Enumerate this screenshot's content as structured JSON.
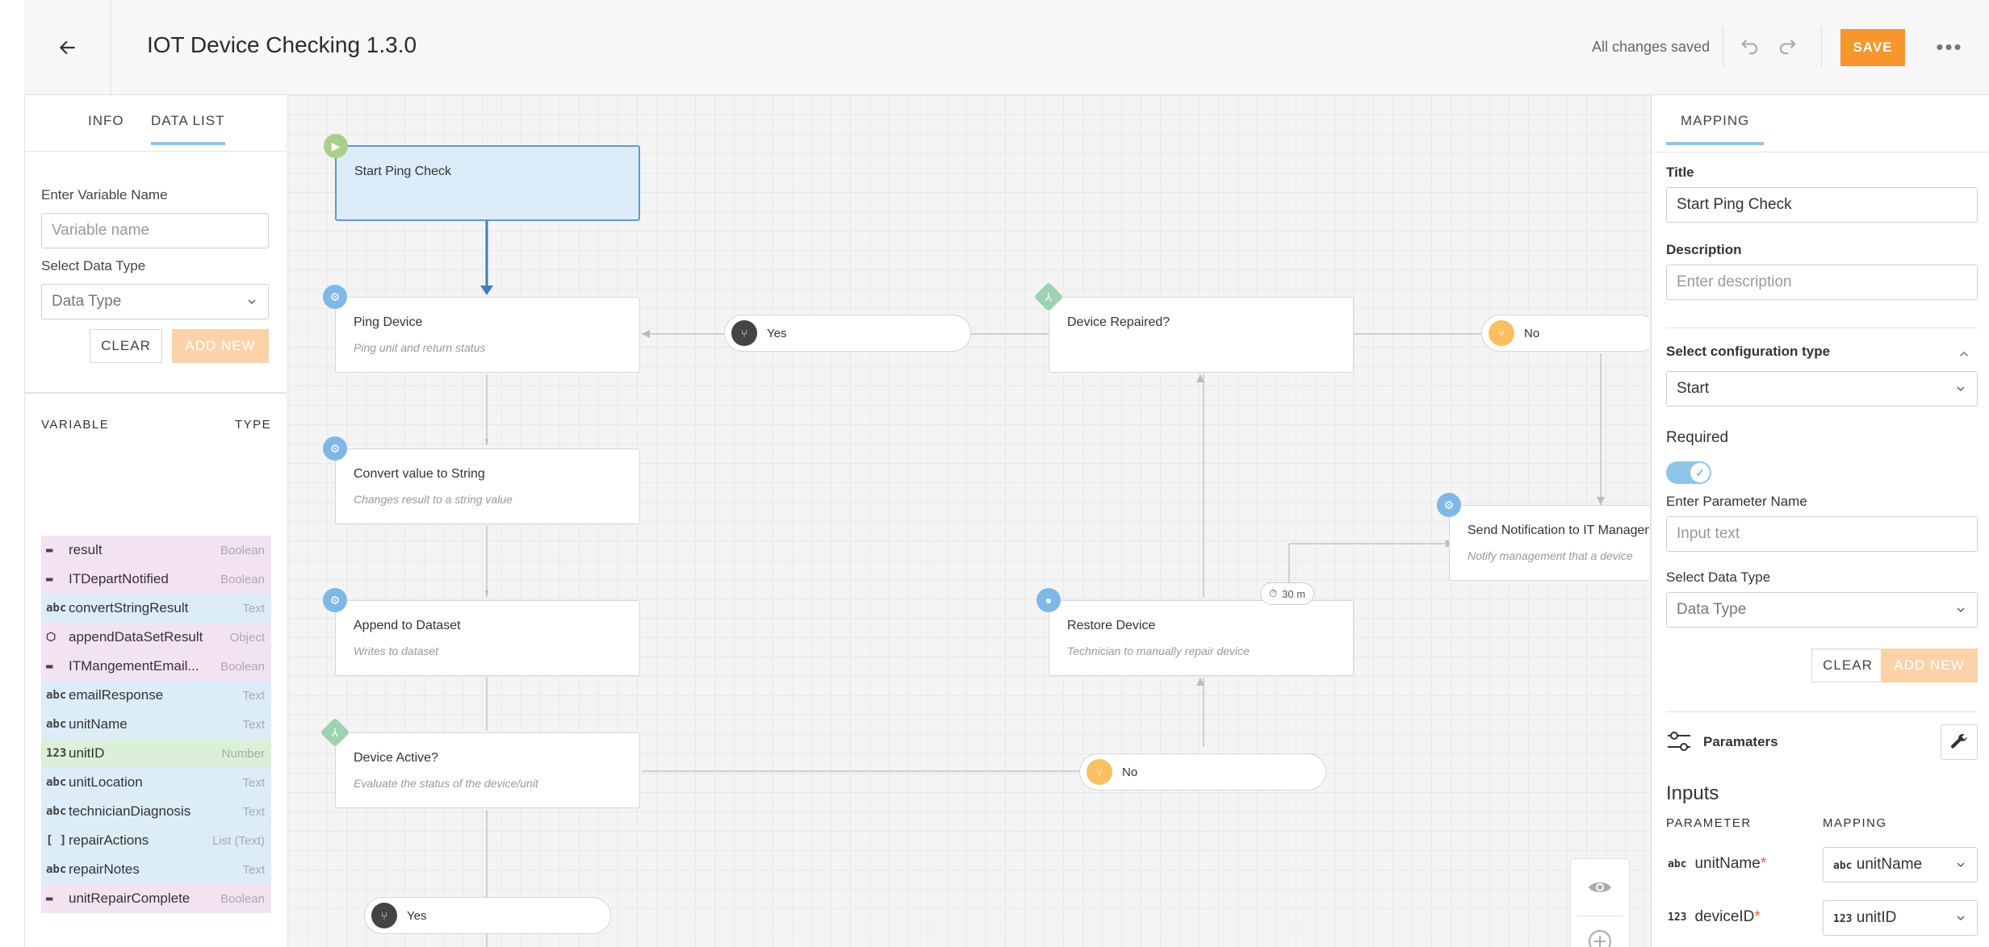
{
  "header": {
    "title": "IOT Device Checking 1.3.0",
    "saved_status": "All changes saved",
    "save_label": "SAVE",
    "more_label": "•••"
  },
  "left_panel": {
    "tabs": [
      {
        "label": "INFO"
      },
      {
        "label": "DATA LIST"
      }
    ],
    "variable_name_label": "Enter Variable Name",
    "variable_name_placeholder": "Variable name",
    "data_type_label": "Select Data Type",
    "data_type_value": "Data Type",
    "clear_label": "CLEAR",
    "add_new_label": "ADD NEW",
    "col_variable": "VARIABLE",
    "col_type": "TYPE",
    "variables": [
      {
        "icon": "▬",
        "name": "result",
        "type": "Boolean",
        "kind": "boolean"
      },
      {
        "icon": "▬",
        "name": "ITDepartNotified",
        "type": "Boolean",
        "kind": "boolean"
      },
      {
        "icon": "abc",
        "name": "convertStringResult",
        "type": "Text",
        "kind": "text"
      },
      {
        "icon": "⬡",
        "name": "appendDataSetResult",
        "type": "Object",
        "kind": "object"
      },
      {
        "icon": "▬",
        "name": "ITMangementEmail...",
        "type": "Boolean",
        "kind": "boolean"
      },
      {
        "icon": "abc",
        "name": "emailResponse",
        "type": "Text",
        "kind": "text"
      },
      {
        "icon": "abc",
        "name": "unitName",
        "type": "Text",
        "kind": "text"
      },
      {
        "icon": "123",
        "name": "unitID",
        "type": "Number",
        "kind": "number"
      },
      {
        "icon": "abc",
        "name": "unitLocation",
        "type": "Text",
        "kind": "text"
      },
      {
        "icon": "abc",
        "name": "technicianDiagnosis",
        "type": "Text",
        "kind": "text"
      },
      {
        "icon": "[ ]",
        "name": "repairActions",
        "type": "List (Text)",
        "kind": "list"
      },
      {
        "icon": "abc",
        "name": "repairNotes",
        "type": "Text",
        "kind": "text"
      },
      {
        "icon": "▬",
        "name": "unitRepairComplete",
        "type": "Boolean",
        "kind": "boolean"
      }
    ]
  },
  "canvas": {
    "nodes": {
      "start": {
        "title": "Start Ping Check",
        "subtitle": ""
      },
      "ping": {
        "title": "Ping Device",
        "subtitle": "Ping unit and return status"
      },
      "convert": {
        "title": "Convert value to String",
        "subtitle": "Changes result to a string value"
      },
      "append": {
        "title": "Append to Dataset",
        "subtitle": "Writes to dataset"
      },
      "active": {
        "title": "Device Active?",
        "subtitle": "Evaluate the status of the device/unit"
      },
      "repaired": {
        "title": "Device Repaired?",
        "subtitle": ""
      },
      "restore": {
        "title": "Restore Device",
        "subtitle": "Technician to manually repair device"
      },
      "notify": {
        "title": "Send Notification to IT Management",
        "subtitle": "Notify management that a device"
      }
    },
    "branches": {
      "yes_top": "Yes",
      "no_top": "No",
      "no_mid": "No",
      "yes_bottom": "Yes"
    },
    "timer": "30 m"
  },
  "right_panel": {
    "tab": "MAPPING",
    "title_label": "Title",
    "title_value": "Start Ping Check",
    "description_label": "Description",
    "description_placeholder": "Enter description",
    "config_label": "Select configuration type",
    "config_value": "Start",
    "required_label": "Required",
    "param_name_label": "Enter Parameter Name",
    "param_name_placeholder": "Input text",
    "data_type_label": "Select Data Type",
    "data_type_value": "Data Type",
    "clear_label": "CLEAR",
    "add_new_label": "ADD NEW",
    "parameters_label": "Paramaters",
    "inputs_label": "Inputs",
    "col_parameter": "PARAMETER",
    "col_mapping": "MAPPING",
    "inputs": [
      {
        "type_icon": "abc",
        "name": "unitName",
        "mapping_icon": "abc",
        "mapping": "unitName"
      },
      {
        "type_icon": "123",
        "name": "deviceID",
        "mapping_icon": "123",
        "mapping": "unitID"
      }
    ]
  },
  "colors": {
    "accent_orange": "#f7962d",
    "accent_blue": "#8fc6e8",
    "selected_node": "#dcecf8"
  }
}
